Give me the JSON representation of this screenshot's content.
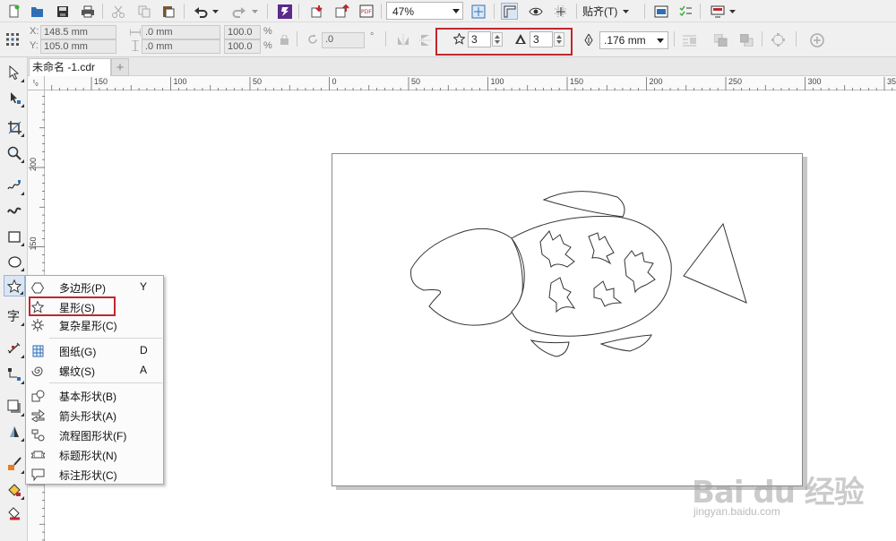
{
  "toolbar": {
    "zoom_value": "47%",
    "snap_menu_label": "贴齐(T)"
  },
  "property_bar": {
    "x_label": "X:",
    "x_value": "148.5 mm",
    "y_label": "Y:",
    "y_value": "105.0 mm",
    "width_value": ".0 mm",
    "height_value": ".0 mm",
    "scale_x_value": "100.0",
    "scale_y_value": "100.0",
    "scale_unit": "%",
    "rotation_value": ".0",
    "rotation_unit": "°",
    "star_points_value": "3",
    "star_sharpness_value": "3",
    "outline_width_value": ".176 mm"
  },
  "document": {
    "tab_title": "未命名 -1.cdr",
    "new_tab_symbol": "+"
  },
  "ruler": {
    "corner_label": "ᵗ₀",
    "top_labels": [
      "150",
      "100",
      "50",
      "0",
      "50",
      "100",
      "150",
      "200",
      "250",
      "300",
      "350"
    ],
    "left_labels": [
      "200",
      "150"
    ]
  },
  "flyout_menu": {
    "items": [
      {
        "label": "多边形(P)",
        "shortcut": "Y"
      },
      {
        "label": "星形(S)",
        "shortcut": ""
      },
      {
        "label": "复杂星形(C)",
        "shortcut": ""
      },
      {
        "label": "图纸(G)",
        "shortcut": "D"
      },
      {
        "label": "螺纹(S)",
        "shortcut": "A"
      },
      {
        "label": "基本形状(B)",
        "shortcut": ""
      },
      {
        "label": "箭头形状(A)",
        "shortcut": ""
      },
      {
        "label": "流程图形状(F)",
        "shortcut": ""
      },
      {
        "label": "标题形状(N)",
        "shortcut": ""
      },
      {
        "label": "标注形状(C)",
        "shortcut": ""
      }
    ]
  },
  "watermark": {
    "brand": "Bai du 经验",
    "url": "jingyan.baidu.com"
  },
  "colors": {
    "highlight_red": "#c0272d",
    "chrome_bg": "#f0f0f0",
    "page_border": "#8a8a8a",
    "page_shadow": "#c7c7c7"
  }
}
